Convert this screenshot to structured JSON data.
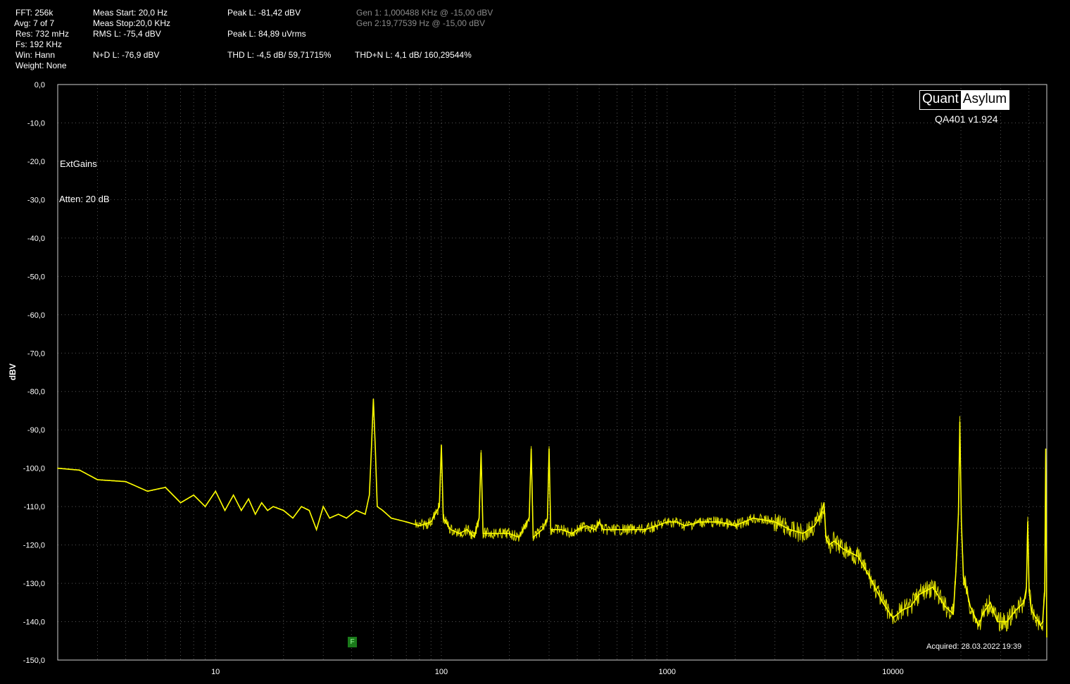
{
  "header": {
    "fft": "FFT: 256k",
    "avg": "Avg: 7 of 7",
    "res": "Res: 732 mHz",
    "fs": "Fs: 192 KHz",
    "win": "Win: Hann",
    "weight": "Weight: None",
    "meas_start": "Meas Start: 20,0 Hz",
    "meas_stop": "Meas Stop:20,0 KHz",
    "rms": "RMS L: -75,4 dBV",
    "nd": "N+D L: -76,9 dBV",
    "peak_dbv": "Peak L: -81,42 dBV",
    "peak_uv": "Peak L: 84,89 uVrms",
    "thd": "THD L: -4,5 dB/ 59,71715%",
    "thdn": "THD+N L: 4,1 dB/ 160,29544%",
    "gen1": "Gen 1: 1,000488 KHz @ -15,00  dBV",
    "gen2": "Gen 2:19,77539 Hz @ -15,00  dBV"
  },
  "annotations": {
    "extgains": "ExtGains",
    "atten": "Atten: 20 dB",
    "marker": "F",
    "stamp": "Acquired: 28.03.2022  19:39"
  },
  "brand": {
    "part1": "Quant",
    "part2": "Asylum",
    "version": "QA401 v1.924"
  },
  "colors": {
    "trace": "#ffff00",
    "grid": "#555555",
    "background": "#000000",
    "marker": "#1a7a1a"
  },
  "chart_data": {
    "type": "line",
    "ylabel": "dBV",
    "xlabel": "",
    "xscale": "log",
    "xlim": [
      2,
      48000
    ],
    "ylim": [
      -150,
      0
    ],
    "x_ticks": [
      "10",
      "100",
      "1000",
      "10000"
    ],
    "y_ticks": [
      "0,0",
      "-10,0",
      "-20,0",
      "-30,0",
      "-40,0",
      "-50,0",
      "-60,0",
      "-70,0",
      "-80,0",
      "-90,0",
      "-100,0",
      "-110,0",
      "-120,0",
      "-130,0",
      "-140,0",
      "-150,0"
    ],
    "series": [
      {
        "x": [
          2,
          2.5,
          3,
          4,
          5,
          6,
          7,
          8,
          9,
          10,
          11,
          12,
          13,
          14,
          15,
          16,
          17,
          18,
          20,
          22,
          24,
          26,
          28,
          30,
          32,
          35,
          38,
          42,
          46,
          48,
          49,
          50,
          51,
          52,
          55,
          60,
          70,
          80,
          90,
          98,
          100,
          102,
          110,
          120,
          130,
          140,
          147,
          150,
          153,
          160,
          180,
          200,
          220,
          245,
          250,
          255,
          280,
          295,
          300,
          305,
          340,
          380,
          400,
          440,
          480,
          500,
          520,
          600,
          700,
          800,
          900,
          1000,
          1100,
          1200,
          1400,
          1700,
          2000,
          2400,
          3000,
          3500,
          4000,
          4500,
          4800,
          4950,
          5050,
          5200,
          5500,
          6000,
          7000,
          8000,
          9000,
          10000,
          11000,
          12000,
          13000,
          15000,
          17000,
          18500,
          19000,
          19500,
          19775,
          20100,
          20500,
          22000,
          24000,
          25000,
          27000,
          29000,
          32000,
          35000,
          38000,
          39000,
          39550,
          40100,
          41000,
          43000,
          45000,
          46000,
          47000,
          47500,
          48000
        ],
        "y": [
          -100,
          -100.5,
          -103,
          -103.5,
          -106,
          -105,
          -109,
          -107,
          -110,
          -106,
          -111,
          -107,
          -111,
          -108,
          -112,
          -109,
          -111,
          -110,
          -111,
          -113,
          -110,
          -111,
          -116,
          -110,
          -113,
          -112,
          -113,
          -111,
          -112,
          -107,
          -95,
          -82,
          -95,
          -110,
          -111,
          -113,
          -114,
          -115,
          -114,
          -110,
          -94,
          -113,
          -116,
          -117,
          -116,
          -118,
          -113,
          -96,
          -117,
          -117,
          -117,
          -117,
          -118,
          -113,
          -95,
          -118,
          -116,
          -113,
          -95,
          -116,
          -116,
          -117,
          -116,
          -115,
          -116,
          -114,
          -116,
          -116,
          -116,
          -116,
          -115,
          -114,
          -114,
          -115,
          -114,
          -114,
          -115,
          -113,
          -114,
          -116,
          -117,
          -115,
          -112,
          -109,
          -118,
          -120,
          -119,
          -121,
          -123,
          -129,
          -135,
          -139,
          -137,
          -136,
          -133,
          -131,
          -136,
          -138,
          -127,
          -112,
          -88,
          -114,
          -128,
          -136,
          -141,
          -138,
          -135,
          -140,
          -140,
          -137,
          -135,
          -131,
          -114,
          -132,
          -137,
          -139,
          -141,
          -140,
          -132,
          -95,
          -144
        ]
      }
    ]
  }
}
